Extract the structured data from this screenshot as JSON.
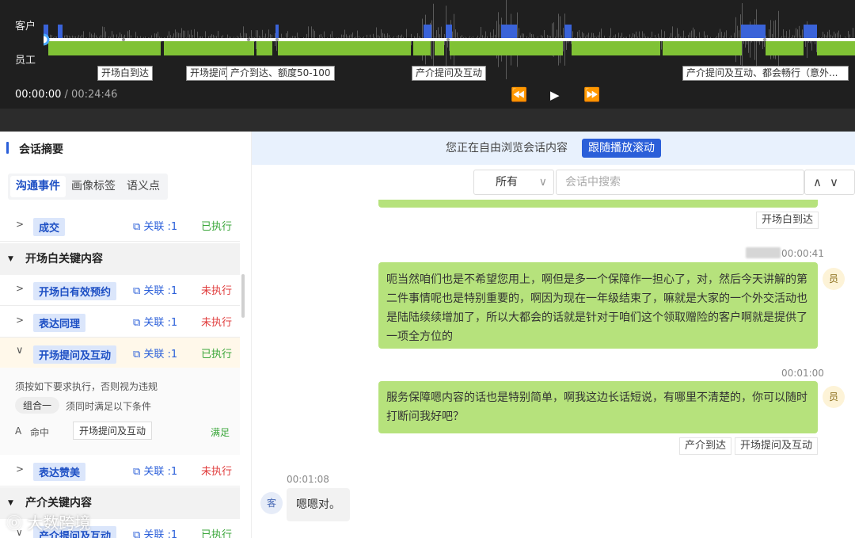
{
  "player": {
    "lane_customer": "客户",
    "lane_employee": "员工",
    "current_time": "00:00:00",
    "separator": " / ",
    "total_time": "00:24:46",
    "progress": 0,
    "segment_labels": [
      "开场白到达",
      "开场提问",
      "产介到达、额度50-100",
      "产介提问及互动",
      "产介提问及互动、都会畅行（意外..."
    ],
    "controls": {
      "rewind": "⏪",
      "play": "▶",
      "forward": "⏩"
    }
  },
  "summary": {
    "title": "会话摘要",
    "tabs": [
      "沟通事件",
      "画像标签",
      "语义点"
    ],
    "rows": [
      {
        "label": "成交",
        "link": "关联 :1",
        "status": "已执行"
      },
      {
        "label": "开场白有效预约",
        "link": "关联 :1",
        "status": "未执行"
      },
      {
        "label": "表达同理",
        "link": "关联 :1",
        "status": "未执行"
      },
      {
        "label": "开场提问及互动",
        "link": "关联 :1",
        "status": "已执行"
      },
      {
        "label": "表达赞美",
        "link": "关联 :1",
        "status": "未执行"
      },
      {
        "label": "产介提问及互动",
        "link": "关联 :1",
        "status": "已执行"
      }
    ],
    "sections": [
      "开场白关键内容",
      "产介关键内容"
    ],
    "detail": {
      "rule": "须按如下要求执行，否则视为违规",
      "group": "组合一",
      "group_desc": "须同时满足以下条件",
      "cond_letter": "A",
      "cond_hit": "命中",
      "cond_tag": "开场提问及互动",
      "cond_result": "满足"
    }
  },
  "conversation": {
    "banner": "您正在自由浏览会话内容",
    "follow_button": "跟随播放滚动",
    "filter": "所有",
    "search_placeholder": "会话中搜索",
    "chip_top": "开场白到达",
    "messages": [
      {
        "time": "00:00:41",
        "avatar": "员",
        "text": "呃当然咱们也是不希望您用上，啊但是多一个保障作一担心了，对，然后今天讲解的第二件事情呢也是特别重要的，啊因为现在一年级结束了，嘛就是大家的一个外交活动也是陆陆续续增加了，所以大都会的话就是针对于咱们这个领取赠险的客户啊就是提供了一项全方位的"
      },
      {
        "time": "00:01:00",
        "avatar": "员",
        "text": "服务保障嗯内容的话也是特别简单，啊我这边长话短说，有哪里不清楚的，你可以随时打断问我好吧？",
        "chips": [
          "产介到达",
          "开场提问及互动"
        ]
      },
      {
        "time": "00:01:08",
        "avatar": "客",
        "text": "嗯嗯对。"
      }
    ]
  },
  "watermark": "大数跨境",
  "colors": {
    "accent": "#2b5fd9",
    "employee_bubble": "#b6e27c",
    "success": "#3aa63a",
    "fail": "#e03b3b"
  }
}
